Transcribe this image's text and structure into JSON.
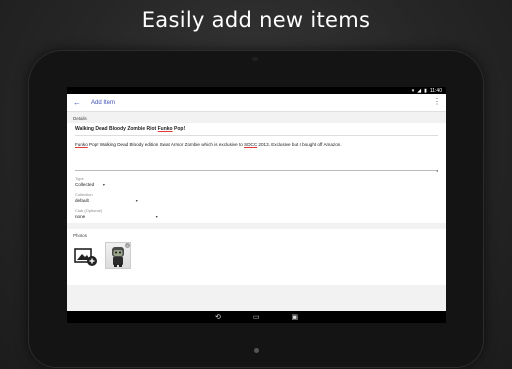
{
  "headline": "Easily add new items",
  "status_bar": {
    "time": "11:40"
  },
  "app_bar": {
    "title": "Add Item"
  },
  "details": {
    "section_label": "Details",
    "title_pre": "Walking Dead Bloody Zombie Riot ",
    "title_link": "Funko",
    "title_post": " Pop!",
    "desc_link1": "Funko",
    "desc_mid": " Pop! Walking Dead Bloody edition Swat Armor Zombie which is exclusive to ",
    "desc_link2": "SDCC",
    "desc_post": " 2013. Exclusive but I bought off Amazon."
  },
  "fields": [
    {
      "label": "Type",
      "value": "Collected"
    },
    {
      "label": "Collection",
      "value": "default"
    },
    {
      "label": "Club (Optional)",
      "value": "none"
    }
  ],
  "photos": {
    "section_label": "Photos"
  }
}
